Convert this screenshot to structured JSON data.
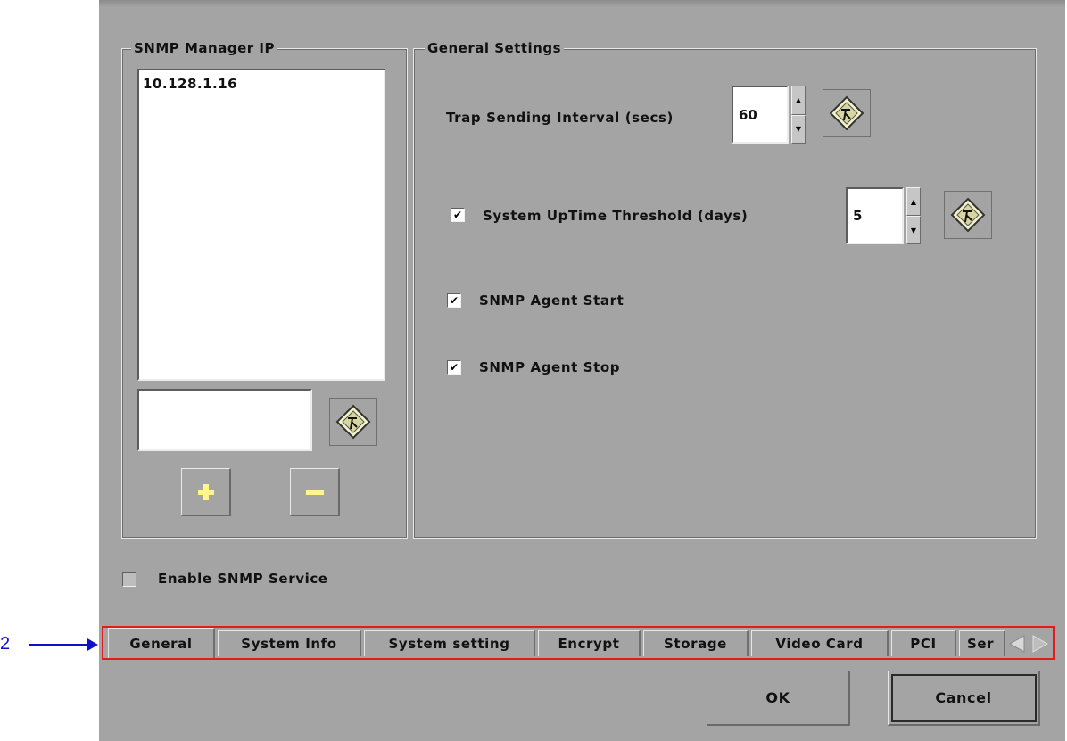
{
  "snmp_manager": {
    "legend": "SNMP Manager IP",
    "ip_list": [
      "10.128.1.16"
    ],
    "ip_input_value": "",
    "add_icon": "plus-icon",
    "remove_icon": "minus-icon",
    "keyboard_icon": "keyboard-icon"
  },
  "general_settings": {
    "legend": "General Settings",
    "trap_interval_label": "Trap Sending Interval (secs)",
    "trap_interval_value": "60",
    "uptime_threshold_label": "System UpTime Threshold (days)",
    "uptime_threshold_value": "5",
    "uptime_threshold_checked": true,
    "agent_start_label": "SNMP Agent Start",
    "agent_start_checked": true,
    "agent_stop_label": "SNMP Agent Stop",
    "agent_stop_checked": true
  },
  "enable_snmp": {
    "label": "Enable SNMP Service",
    "checked": false
  },
  "tabs": [
    {
      "label": "General",
      "active": true
    },
    {
      "label": "System Info"
    },
    {
      "label": "System setting"
    },
    {
      "label": "Encrypt"
    },
    {
      "label": "Storage"
    },
    {
      "label": "Video Card"
    },
    {
      "label": "PCI"
    },
    {
      "label": "Ser"
    }
  ],
  "footer": {
    "ok_label": "OK",
    "cancel_label": "Cancel"
  },
  "annotation": {
    "label": "2",
    "color": "#1010c8",
    "highlight_color": "#e31b1b"
  },
  "check_mark": "✔",
  "colors": {
    "panel_bg": "#a4a4a4"
  }
}
